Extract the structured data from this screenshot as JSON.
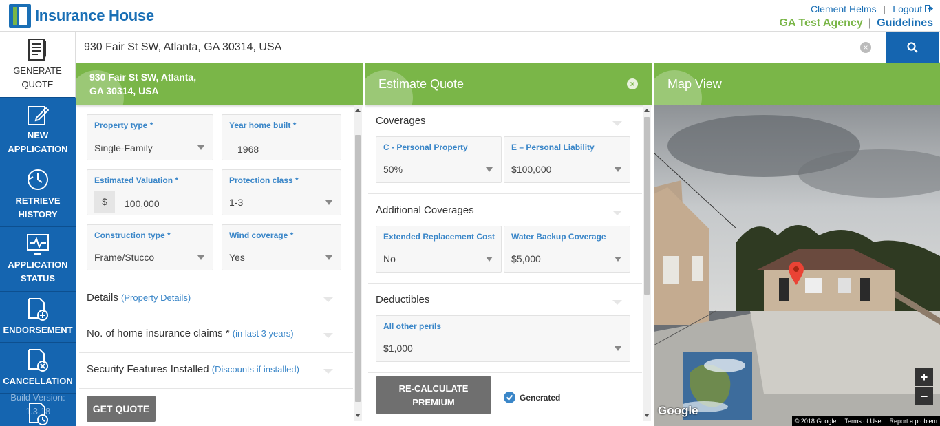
{
  "header": {
    "logo_text": "Insurance House",
    "user_name": "Clement Helms",
    "sep": "|",
    "logout": "Logout",
    "agency": "GA Test Agency",
    "guidelines": "Guidelines"
  },
  "sidebar": {
    "items": [
      {
        "label_1": "GENERATE",
        "label_2": "QUOTE"
      },
      {
        "label_1": "NEW",
        "label_2": "APPLICATION"
      },
      {
        "label_1": "RETRIEVE",
        "label_2": "HISTORY"
      },
      {
        "label_1": "APPLICATION",
        "label_2": "STATUS"
      },
      {
        "label_1": "ENDORSEMENT"
      },
      {
        "label_1": "CANCELLATION"
      }
    ],
    "build_label": "Build Version:",
    "build_value": "1.3.18"
  },
  "search": {
    "value": "930 Fair St SW, Atlanta, GA 30314, USA"
  },
  "property_panel": {
    "address_line1": "930 Fair St SW, Atlanta,",
    "address_line2": "GA 30314, USA",
    "fields": {
      "property_type": {
        "label": "Property type *",
        "value": "Single-Family"
      },
      "year_built": {
        "label": "Year home built *",
        "value": "1968"
      },
      "valuation": {
        "label": "Estimated Valuation *",
        "prefix": "$",
        "value": "100,000"
      },
      "protection_class": {
        "label": "Protection class *",
        "value": "1-3"
      },
      "construction": {
        "label": "Construction type *",
        "value": "Frame/Stucco"
      },
      "wind": {
        "label": "Wind coverage *",
        "value": "Yes"
      }
    },
    "details": {
      "title": "Details",
      "sub": "(Property Details)"
    },
    "claims": {
      "title": "No. of home insurance claims *",
      "sub": "(in last 3 years)"
    },
    "security": {
      "title": "Security Features Installed",
      "sub": "(Discounts if installed)"
    },
    "get_quote": "GET QUOTE"
  },
  "quote_panel": {
    "title": "Estimate Quote",
    "coverages": {
      "title": "Coverages",
      "c": {
        "label": "C - Personal Property",
        "value": "50%"
      },
      "e": {
        "label": "E – Personal Liability",
        "value": "$100,000"
      }
    },
    "additional": {
      "title": "Additional Coverages",
      "erc": {
        "label": "Extended Replacement Cost",
        "value": "No"
      },
      "wbc": {
        "label": "Water Backup Coverage",
        "value": "$5,000"
      }
    },
    "deductibles": {
      "title": "Deductibles",
      "aop": {
        "label": "All other perils",
        "value": "$1,000"
      }
    },
    "recalc_1": "RE-CALCULATE",
    "recalc_2": "PREMIUM",
    "generated": "Generated"
  },
  "map_panel": {
    "title": "Map View",
    "google": "Google",
    "copyright": "© 2018 Google",
    "terms": "Terms of Use",
    "report": "Report a problem",
    "zoom_in": "+",
    "zoom_out": "−"
  }
}
